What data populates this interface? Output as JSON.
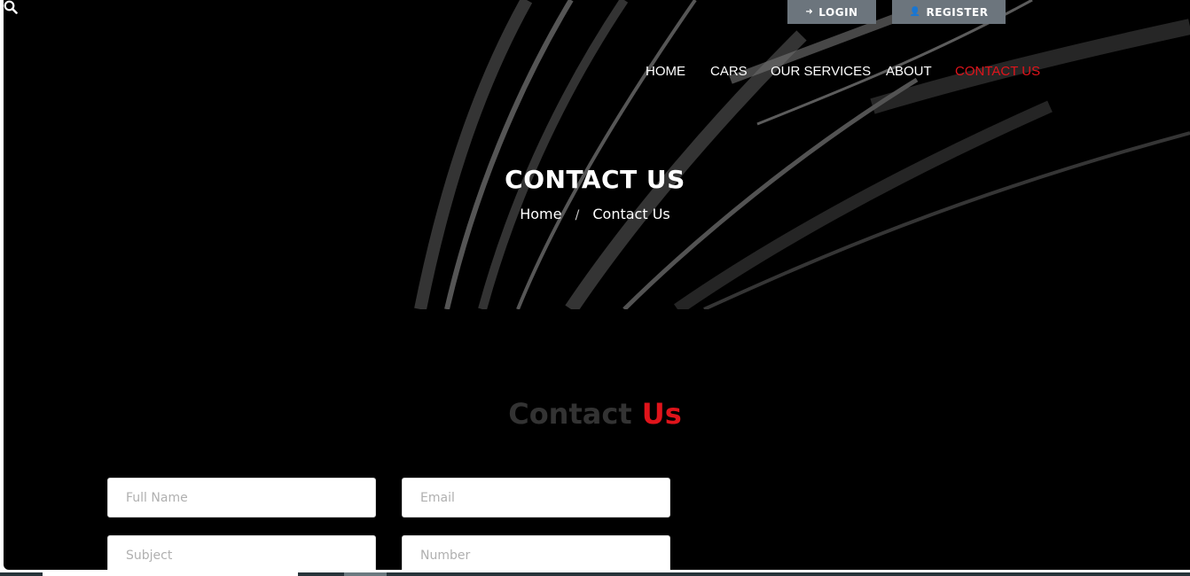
{
  "header": {
    "login_label": "LOGIN",
    "register_label": "REGISTER",
    "login_icon": "sign-in-icon",
    "register_icon": "user-plus-icon"
  },
  "nav": {
    "items": [
      {
        "label": "HOME",
        "active": false
      },
      {
        "label": "CARS",
        "active": false
      },
      {
        "label": "OUR SERVICES",
        "active": false
      },
      {
        "label": "ABOUT",
        "active": false
      },
      {
        "label": "CONTACT US",
        "active": true
      }
    ],
    "search_icon": "search-icon"
  },
  "hero": {
    "title": "CONTACT US",
    "breadcrumb": {
      "home": "Home",
      "separator": "/",
      "current": "Contact Us"
    }
  },
  "contact": {
    "title_part1": "Contact",
    "title_part2": "Us",
    "fields": {
      "full_name": {
        "placeholder": "Full Name",
        "value": ""
      },
      "email": {
        "placeholder": "Email",
        "value": ""
      },
      "subject": {
        "placeholder": "Subject",
        "value": ""
      },
      "number": {
        "placeholder": "Number",
        "value": ""
      }
    }
  },
  "colors": {
    "accent": "#e0141b",
    "background": "#000000",
    "button_gray": "#6c757d",
    "title_gray": "#333333"
  }
}
